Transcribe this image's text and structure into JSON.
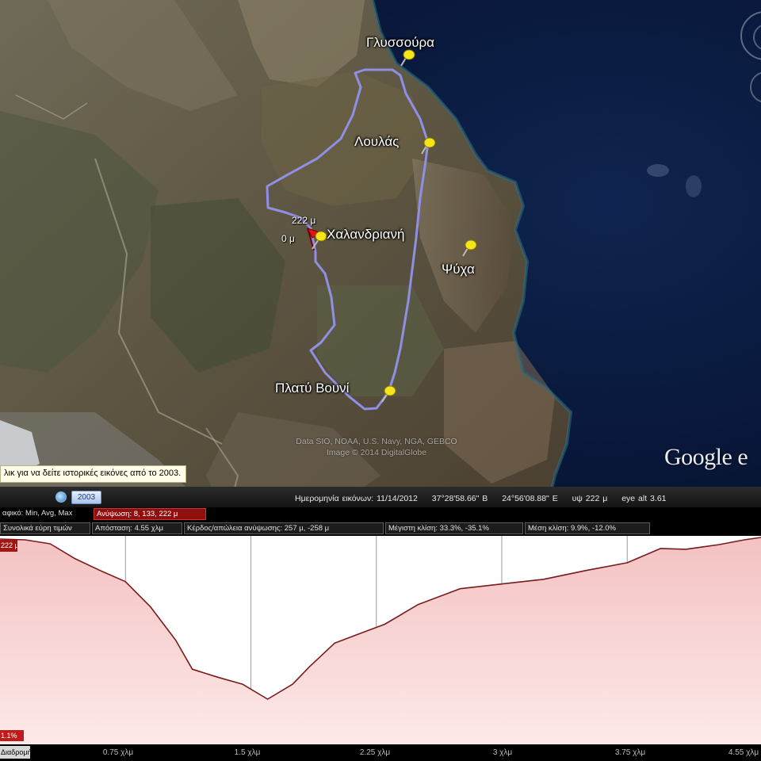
{
  "map": {
    "placemarks": [
      {
        "name": "Γλυσσούρα",
        "pin": "yellow"
      },
      {
        "name": "Λουλάς",
        "pin": "yellow"
      },
      {
        "name": "Χαλανδριανή",
        "pin": "red-yellow"
      },
      {
        "name": "Ψύχα",
        "pin": "yellow"
      },
      {
        "name": "Πλατύ Βουνί",
        "pin": "yellow"
      }
    ],
    "marker_labels": {
      "max_elev": "222 μ",
      "zero": "0 μ"
    },
    "attribution_line1": "Data SIO, NOAA, U.S. Navy, NGA, GEBCO",
    "attribution_line2": "Image © 2014 DigitalGlobe",
    "history_tooltip": "λικ για να δείτε ιστορικές εικόνες από το 2003.",
    "history_year": "2003",
    "logo_text": "Google e",
    "colors": {
      "route": "#8f8fe6",
      "sea": "#0b1a3c",
      "pin_yellow": "#f5e61c",
      "pin_red": "#e0161a"
    }
  },
  "status_bar": {
    "imagery_date": "Ημερομηνία εικόνων: 11/14/2012",
    "latitude": "37°28'58.66\" B",
    "longitude": "24°56'08.88\" E",
    "elev": "υψ  222 μ",
    "eye_alt": "eye alt  3.61"
  },
  "profile_toolbar": {
    "row1": [
      "αφικό: Min, Avg, Max",
      "Ανύψωση: 8, 133, 222 μ"
    ],
    "row2": [
      "Συνολικά εύρη τιμών",
      "Απόσταση: 4.55 χλμ",
      "Κέρδος/απώλεια ανύψωσης: 257 μ, -258 μ",
      "Μέγιστη κλίση: 33.3%, -35.1%",
      "Μέση κλίση: 9.9%, -12.0%"
    ]
  },
  "profile": {
    "elev_badge": "222 μ",
    "slope_badge": "1.1%",
    "axis_left": "Διαδρομή",
    "x_ticks": [
      "0.75 χλμ",
      "1.5 χλμ",
      "2.25 χλμ",
      "3 χλμ",
      "3.75 χλμ",
      "4.55 χλμ"
    ]
  },
  "chart_data": {
    "type": "area",
    "xlabel": "",
    "ylabel": "",
    "x": [
      0,
      0.15,
      0.3,
      0.45,
      0.6,
      0.75,
      0.9,
      1.05,
      1.15,
      1.3,
      1.45,
      1.6,
      1.75,
      1.85,
      2.0,
      2.15,
      2.3,
      2.5,
      2.75,
      3.0,
      3.25,
      3.5,
      3.75,
      3.95,
      4.1,
      4.3,
      4.45,
      4.55
    ],
    "values": [
      220,
      219,
      214,
      195,
      180,
      166,
      134,
      92,
      55,
      45,
      36,
      17,
      36,
      58,
      88,
      100,
      112,
      137,
      157,
      163,
      169,
      180,
      190,
      208,
      207,
      213,
      219,
      222
    ],
    "ylim": [
      8,
      222
    ],
    "xlim": [
      0,
      4.55
    ],
    "grid": true,
    "colors": {
      "line": "#7a1a1a",
      "fill_top": "#f4c2c2",
      "fill_bottom": "#fde9e9"
    }
  }
}
